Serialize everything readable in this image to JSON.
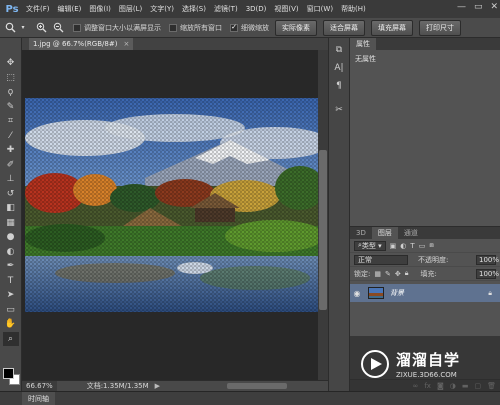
{
  "app": {
    "logo": "Ps"
  },
  "menu": [
    "文件(F)",
    "编辑(E)",
    "图像(I)",
    "图层(L)",
    "文字(Y)",
    "选择(S)",
    "滤镜(T)",
    "3D(D)",
    "视图(V)",
    "窗口(W)",
    "帮助(H)"
  ],
  "window_controls": {
    "minimize": "—",
    "restore": "▭",
    "close": "✕"
  },
  "options_bar": {
    "tool_icon": "zoom-icon",
    "checks": [
      {
        "label": "调整窗口大小以满屏显示",
        "checked": false
      },
      {
        "label": "缩放所有窗口",
        "checked": false
      },
      {
        "label": "细微缩放",
        "checked": true
      }
    ],
    "buttons": [
      "实际像素",
      "适合屏幕",
      "填充屏幕",
      "打印尺寸"
    ]
  },
  "document": {
    "tab_title": "1.jpg @ 66.7%(RGB/8#)",
    "tab_close": "×",
    "zoom": "66.67%",
    "info": "文档:1.35M/1.35M",
    "status_arrow": "▶"
  },
  "timeline": {
    "label": "时间轴"
  },
  "properties": {
    "tab": "属性",
    "empty_text": "无属性"
  },
  "layers": {
    "tabs": [
      "3D",
      "图层",
      "通道"
    ],
    "kind_label": "类型",
    "blend_mode": "正常",
    "opacity_label": "不透明度:",
    "opacity_value": "100%",
    "lock_label": "锁定:",
    "fill_label": "填充:",
    "fill_value": "100%",
    "layer_name": "背景"
  },
  "watermark": {
    "title": "溜溜自学",
    "subtitle": "ZIXUE.3D66.COM"
  },
  "colors": {
    "accent": "#5f7290",
    "panel": "#535353",
    "canvas_bg": "#282828"
  }
}
